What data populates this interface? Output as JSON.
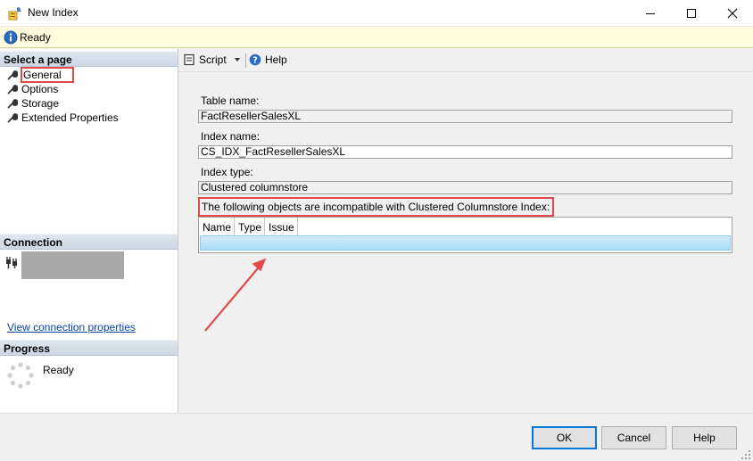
{
  "window": {
    "title": "New Index"
  },
  "status": {
    "text": "Ready"
  },
  "left_pane": {
    "select_page_header": "Select a page",
    "pages": [
      {
        "label": "General"
      },
      {
        "label": "Options"
      },
      {
        "label": "Storage"
      },
      {
        "label": "Extended Properties"
      }
    ],
    "connection_header": "Connection",
    "view_connection_link": "View connection properties",
    "progress_header": "Progress",
    "progress_status": "Ready"
  },
  "toolbar": {
    "script_label": "Script",
    "help_label": "Help"
  },
  "form": {
    "table_name_label": "Table name:",
    "table_name_value": "FactResellerSalesXL",
    "index_name_label": "Index name:",
    "index_name_value": "CS_IDX_FactResellerSalesXL",
    "index_type_label": "Index type:",
    "index_type_value": "Clustered columnstore",
    "incompatible_label": "The following objects are incompatible with Clustered Columnstore Index:",
    "grid_columns": [
      "Name",
      "Type",
      "Issue"
    ]
  },
  "buttons": {
    "ok": "OK",
    "cancel": "Cancel",
    "help": "Help"
  },
  "colors": {
    "highlight_red": "#e24a4a",
    "selection_blue": "#a9dbf6",
    "link_blue": "#0645ad",
    "ok_border": "#0078d7"
  },
  "icons": {
    "app": "new-index-app-icon",
    "info": "info-icon",
    "page": "wrench-icon",
    "connection": "plug-icon",
    "script": "script-icon",
    "help": "help-question-icon"
  }
}
